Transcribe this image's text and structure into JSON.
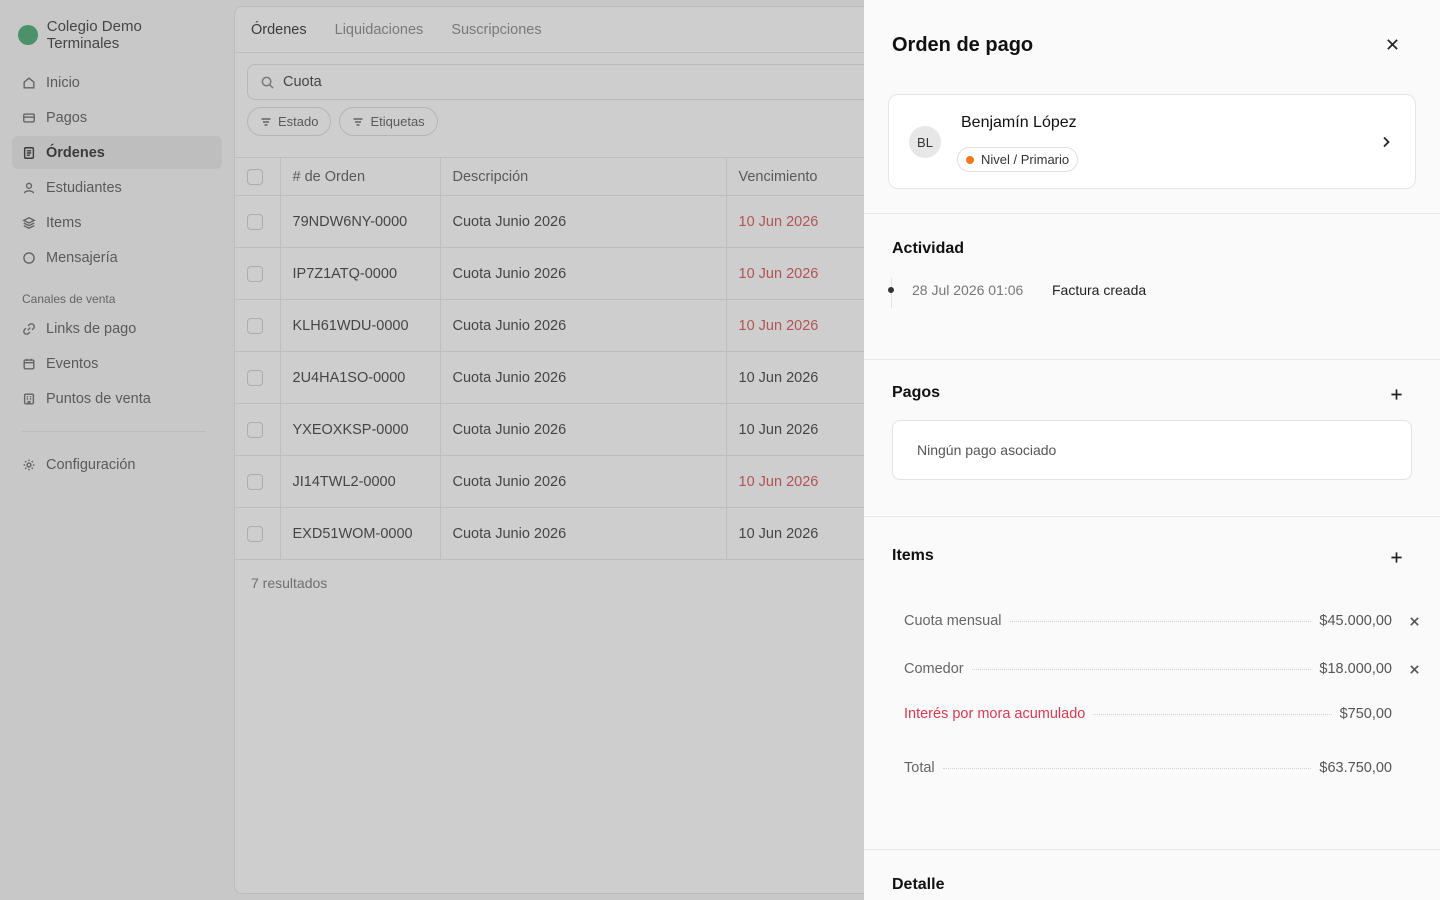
{
  "sidebar": {
    "org_name": "Colegio Demo Terminales",
    "items": [
      {
        "label": "Inicio",
        "icon": "home-icon"
      },
      {
        "label": "Pagos",
        "icon": "card-icon"
      },
      {
        "label": "Órdenes",
        "icon": "document-icon",
        "active": true
      },
      {
        "label": "Estudiantes",
        "icon": "user-icon"
      },
      {
        "label": "Items",
        "icon": "layers-icon"
      },
      {
        "label": "Mensajería",
        "icon": "chat-icon"
      }
    ],
    "section_label": "Canales de venta",
    "channels": [
      {
        "label": "Links de pago",
        "icon": "link-icon"
      },
      {
        "label": "Eventos",
        "icon": "calendar-icon"
      },
      {
        "label": "Puntos de venta",
        "icon": "store-icon"
      }
    ],
    "settings_label": "Configuración"
  },
  "main": {
    "tabs": [
      "Órdenes",
      "Liquidaciones",
      "Suscripciones"
    ],
    "search_value": "Cuota",
    "filters": [
      "Estado",
      "Etiquetas"
    ],
    "columns": [
      "# de Orden",
      "Descripción",
      "Vencimiento"
    ],
    "rows": [
      {
        "id": "79NDW6NY-0000",
        "description": "Cuota Junio 2026",
        "due": "10 Jun 2026",
        "overdue": true
      },
      {
        "id": "IP7Z1ATQ-0000",
        "description": "Cuota Junio 2026",
        "due": "10 Jun 2026",
        "overdue": true
      },
      {
        "id": "KLH61WDU-0000",
        "description": "Cuota Junio 2026",
        "due": "10 Jun 2026",
        "overdue": true
      },
      {
        "id": "2U4HA1SO-0000",
        "description": "Cuota Junio 2026",
        "due": "10 Jun 2026",
        "overdue": false
      },
      {
        "id": "YXEOXKSP-0000",
        "description": "Cuota Junio 2026",
        "due": "10 Jun 2026",
        "overdue": false
      },
      {
        "id": "JI14TWL2-0000",
        "description": "Cuota Junio 2026",
        "due": "10 Jun 2026",
        "overdue": true
      },
      {
        "id": "EXD51WOM-0000",
        "description": "Cuota Junio 2026",
        "due": "10 Jun 2026",
        "overdue": false
      }
    ],
    "results_text": "7 resultados"
  },
  "drawer": {
    "title": "Orden de pago",
    "student": {
      "initials": "BL",
      "name": "Benjamín López",
      "level": "Nivel / Primario"
    },
    "activity_title": "Actividad",
    "activity": [
      {
        "time": "28 Jul 2026 01:06",
        "event": "Factura creada"
      }
    ],
    "payments_title": "Pagos",
    "payments_empty": "Ningún pago asociado",
    "items_title": "Items",
    "items": [
      {
        "label": "Cuota mensual",
        "amount": "$45.000,00",
        "removable": true
      },
      {
        "label": "Comedor",
        "amount": "$18.000,00",
        "removable": true
      },
      {
        "label": "Interés por mora acumulado",
        "amount": "$750,00",
        "removable": false,
        "warning": true
      }
    ],
    "total_label": "Total",
    "total_amount": "$63.750,00",
    "detail_title": "Detalle"
  },
  "colors": {
    "overdue": "#d23a3a",
    "warning": "#d63a52",
    "level_dot": "#f07a1b",
    "brand": "#2e9e5b"
  }
}
